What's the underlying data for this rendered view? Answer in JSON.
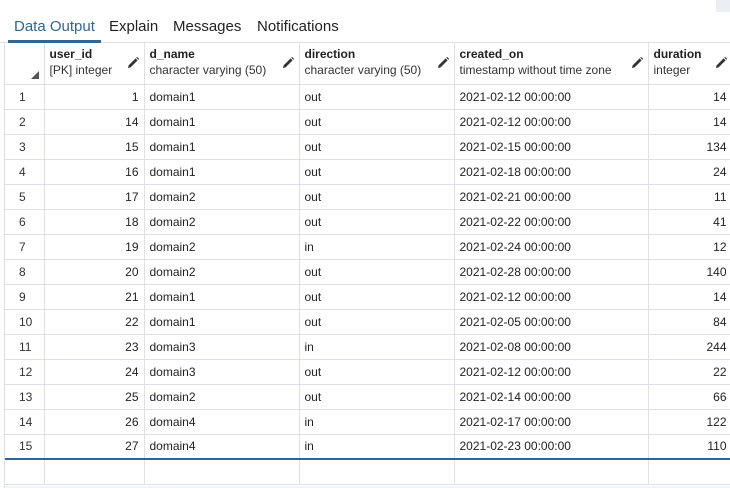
{
  "tabs": [
    {
      "label": "Data Output",
      "active": true
    },
    {
      "label": "Explain",
      "active": false
    },
    {
      "label": "Messages",
      "active": false
    },
    {
      "label": "Notifications",
      "active": false
    }
  ],
  "columns": [
    {
      "name": "user_id",
      "type": "[PK] integer",
      "align": "right"
    },
    {
      "name": "d_name",
      "type": "character varying (50)",
      "align": "left"
    },
    {
      "name": "direction",
      "type": "character varying (50)",
      "align": "left"
    },
    {
      "name": "created_on",
      "type": "timestamp without time zone",
      "align": "left"
    },
    {
      "name": "duration",
      "type": "integer",
      "align": "right"
    }
  ],
  "rows": [
    [
      "1",
      "1",
      "domain1",
      "out",
      "2021-02-12 00:00:00",
      "14"
    ],
    [
      "2",
      "14",
      "domain1",
      "out",
      "2021-02-12 00:00:00",
      "14"
    ],
    [
      "3",
      "15",
      "domain1",
      "out",
      "2021-02-15 00:00:00",
      "134"
    ],
    [
      "4",
      "16",
      "domain1",
      "out",
      "2021-02-18 00:00:00",
      "24"
    ],
    [
      "5",
      "17",
      "domain2",
      "out",
      "2021-02-21 00:00:00",
      "11"
    ],
    [
      "6",
      "18",
      "domain2",
      "out",
      "2021-02-22 00:00:00",
      "41"
    ],
    [
      "7",
      "19",
      "domain2",
      "in",
      "2021-02-24 00:00:00",
      "12"
    ],
    [
      "8",
      "20",
      "domain2",
      "out",
      "2021-02-28 00:00:00",
      "140"
    ],
    [
      "9",
      "21",
      "domain1",
      "out",
      "2021-02-12 00:00:00",
      "14"
    ],
    [
      "10",
      "22",
      "domain1",
      "out",
      "2021-02-05 00:00:00",
      "84"
    ],
    [
      "11",
      "23",
      "domain3",
      "in",
      "2021-02-08 00:00:00",
      "244"
    ],
    [
      "12",
      "24",
      "domain3",
      "out",
      "2021-02-12 00:00:00",
      "22"
    ],
    [
      "13",
      "25",
      "domain2",
      "out",
      "2021-02-14 00:00:00",
      "66"
    ],
    [
      "14",
      "26",
      "domain4",
      "in",
      "2021-02-17 00:00:00",
      "122"
    ],
    [
      "15",
      "27",
      "domain4",
      "in",
      "2021-02-23 00:00:00",
      "110"
    ]
  ],
  "colors": {
    "accent": "#326690",
    "border": "#dde0e6"
  },
  "icons": {
    "edit": "pencil-icon",
    "sort": "sort-corner-icon"
  }
}
